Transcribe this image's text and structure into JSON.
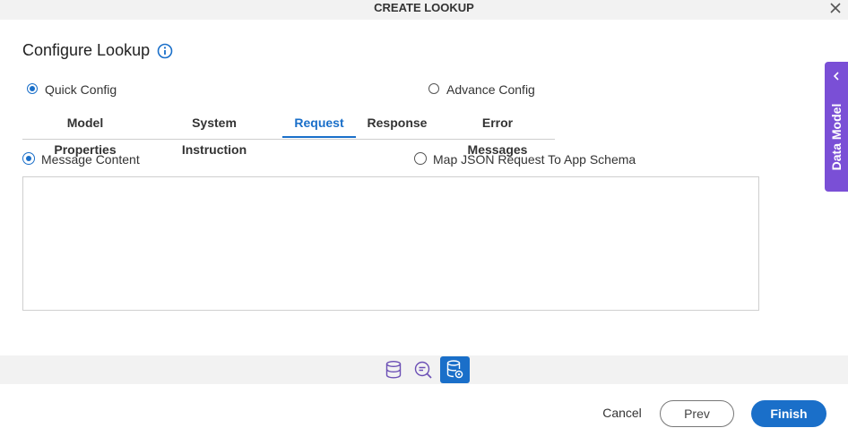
{
  "dialog": {
    "title": "CREATE LOOKUP",
    "close_icon": "close-icon"
  },
  "header": {
    "heading": "Configure Lookup",
    "info_icon": "info-icon"
  },
  "config_mode": {
    "options": [
      {
        "label": "Quick Config",
        "selected": true
      },
      {
        "label": "Advance Config",
        "selected": false
      }
    ]
  },
  "tabs": [
    {
      "label": "Model Properties",
      "active": false
    },
    {
      "label": "System Instruction",
      "active": false
    },
    {
      "label": "Request",
      "active": true
    },
    {
      "label": "Response",
      "active": false
    },
    {
      "label": "Error Messages",
      "active": false
    }
  ],
  "request": {
    "options": [
      {
        "label": "Message Content",
        "selected": true
      },
      {
        "label": "Map JSON Request To App Schema",
        "selected": false
      }
    ],
    "message_value": ""
  },
  "side_panel": {
    "label": "Data Model",
    "icon": "chevron-left-icon"
  },
  "toolbar": {
    "tools": [
      "database-icon",
      "search-list-icon",
      "database-settings-icon"
    ],
    "active_tool": "database-settings-icon"
  },
  "footer": {
    "cancel_label": "Cancel",
    "prev_label": "Prev",
    "finish_label": "Finish"
  },
  "colors": {
    "accent": "#1a6fc9",
    "side_panel": "#7a4fd6",
    "strip_bg": "#f2f2f2"
  }
}
